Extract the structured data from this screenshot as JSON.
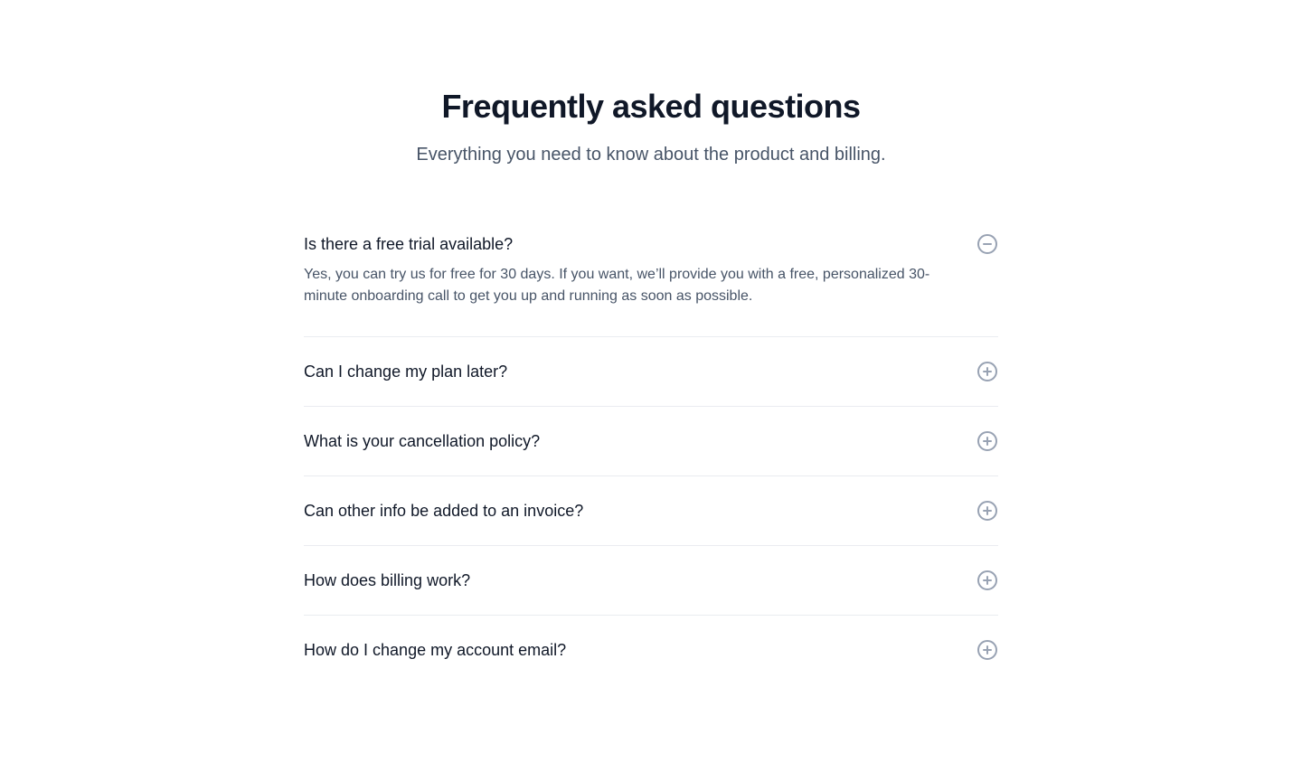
{
  "header": {
    "title": "Frequently asked questions",
    "subtitle": "Everything you need to know about the product and billing."
  },
  "faqs": [
    {
      "question": "Is there a free trial available?",
      "answer": "Yes, you can try us for free for 30 days. If you want, we’ll provide you with a free, personalized 30-minute onboarding call to get you up and running as soon as possible.",
      "expanded": true,
      "icon": "minus-circle-icon"
    },
    {
      "question": "Can I change my plan later?",
      "expanded": false,
      "icon": "plus-circle-icon"
    },
    {
      "question": "What is your cancellation policy?",
      "expanded": false,
      "icon": "plus-circle-icon"
    },
    {
      "question": "Can other info be added to an invoice?",
      "expanded": false,
      "icon": "plus-circle-icon"
    },
    {
      "question": "How does billing work?",
      "expanded": false,
      "icon": "plus-circle-icon"
    },
    {
      "question": "How do I change my account email?",
      "expanded": false,
      "icon": "plus-circle-icon"
    }
  ],
  "colors": {
    "heading": "#101828",
    "body_text": "#475467",
    "icon": "#98a2b3",
    "divider": "#eaecf0"
  }
}
